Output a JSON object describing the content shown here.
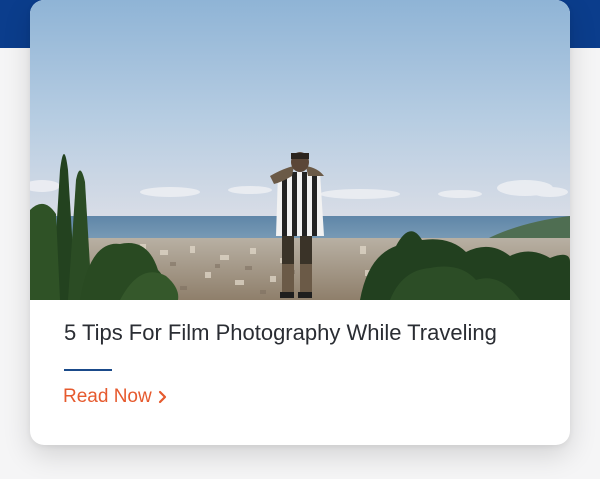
{
  "article": {
    "title": "5 Tips For Film Photography While Traveling",
    "cta_label": "Read Now",
    "cta_icon": "chevron-right-icon",
    "image_alt": "Photographer overlooking a coastal city"
  },
  "colors": {
    "header_band": "#0b3d8c",
    "cta": "#e65a2e",
    "divider": "#1a4a8a",
    "title": "#2a2d33"
  }
}
